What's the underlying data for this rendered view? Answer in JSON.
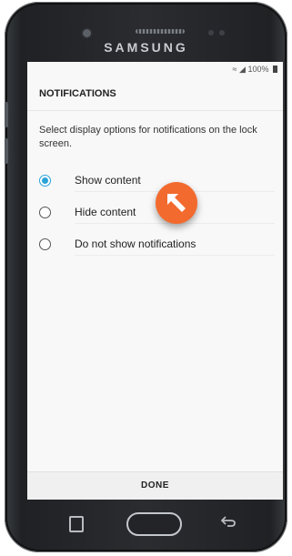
{
  "device": {
    "brand": "SAMSUNG"
  },
  "status_bar": {
    "battery": "100%"
  },
  "screen": {
    "title": "NOTIFICATIONS",
    "description": "Select display options for notifications on the lock screen.",
    "options": [
      {
        "label": "Show content",
        "selected": true
      },
      {
        "label": "Hide content",
        "selected": false
      },
      {
        "label": "Do not show notifications",
        "selected": false
      }
    ],
    "done_label": "DONE"
  },
  "colors": {
    "accent": "#2ba3d9",
    "cursor": "#f26a2e"
  }
}
